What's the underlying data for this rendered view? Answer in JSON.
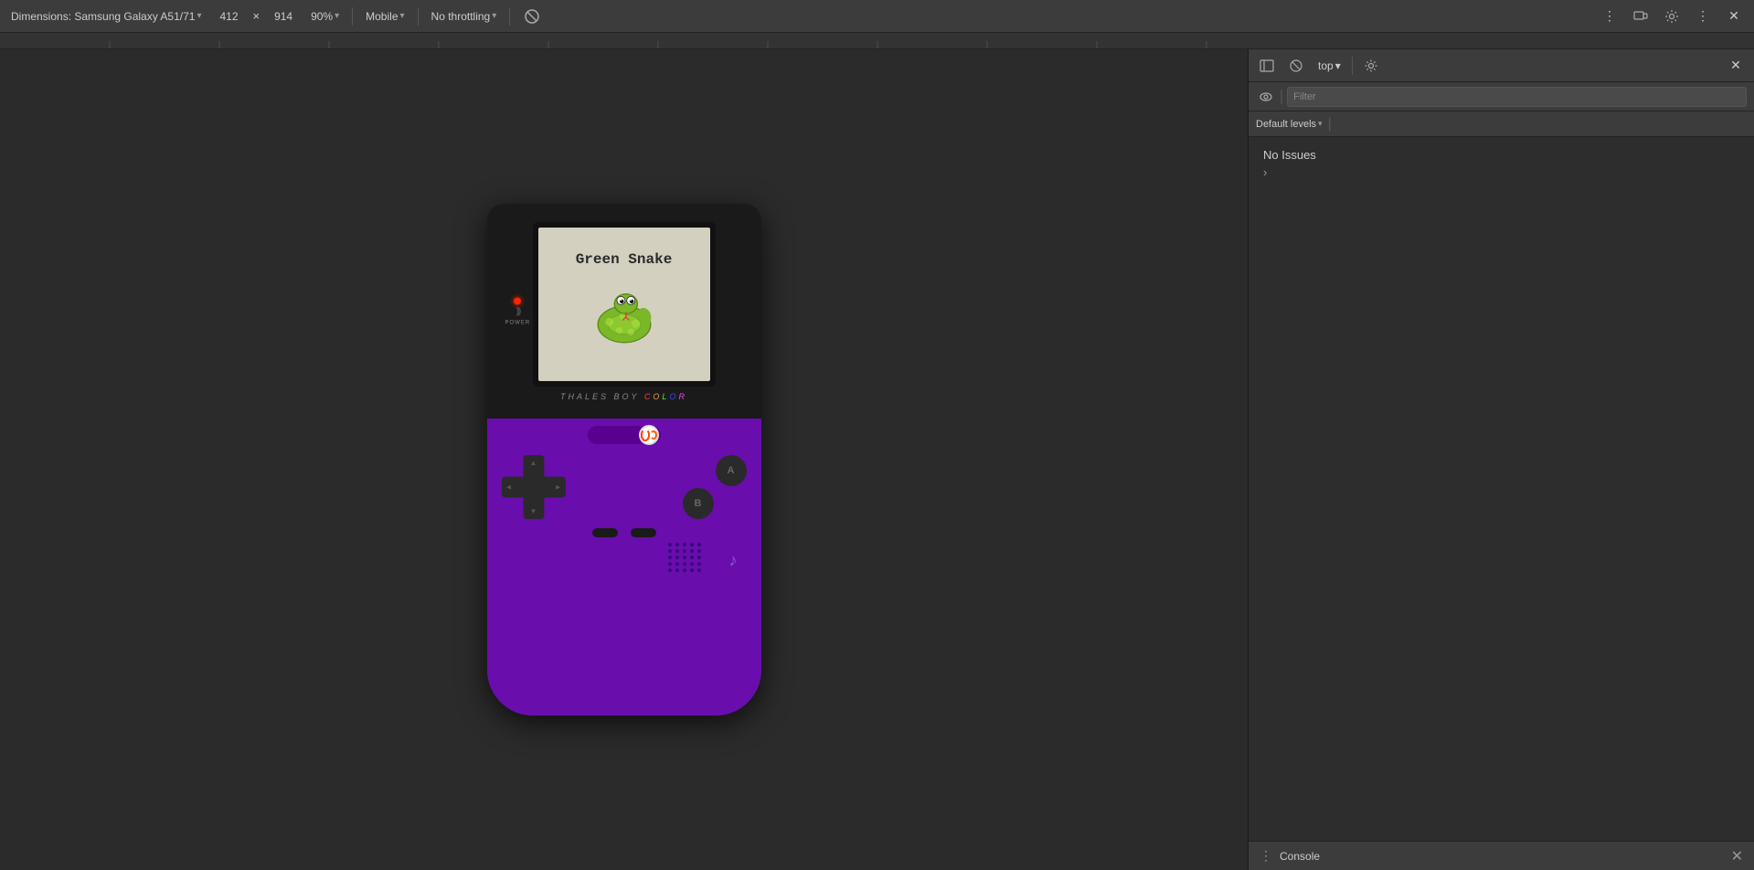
{
  "toolbar": {
    "dimensions_label": "Dimensions: Samsung Galaxy A51/71",
    "dimensions_arrow": "▾",
    "width": "412",
    "height_x": "×",
    "height": "914",
    "zoom": "90%",
    "zoom_arrow": "▾",
    "mobile_label": "Mobile",
    "mobile_arrow": "▾",
    "throttle_label": "No throttling",
    "throttle_arrow": "▾"
  },
  "devtools": {
    "top_label": "top",
    "top_arrow": "▾",
    "filter_placeholder": "Filter",
    "default_levels_label": "Default levels",
    "default_levels_arrow": "▾",
    "no_issues": "No Issues"
  },
  "console": {
    "label": "Console",
    "dots": "⋮",
    "close": "✕"
  },
  "gameboy": {
    "game_title": "Green Snake",
    "brand_text": "THALES BOY ",
    "brand_color": "COLOR",
    "power_text": "POWER",
    "btn_a": "A",
    "btn_b": "B"
  }
}
